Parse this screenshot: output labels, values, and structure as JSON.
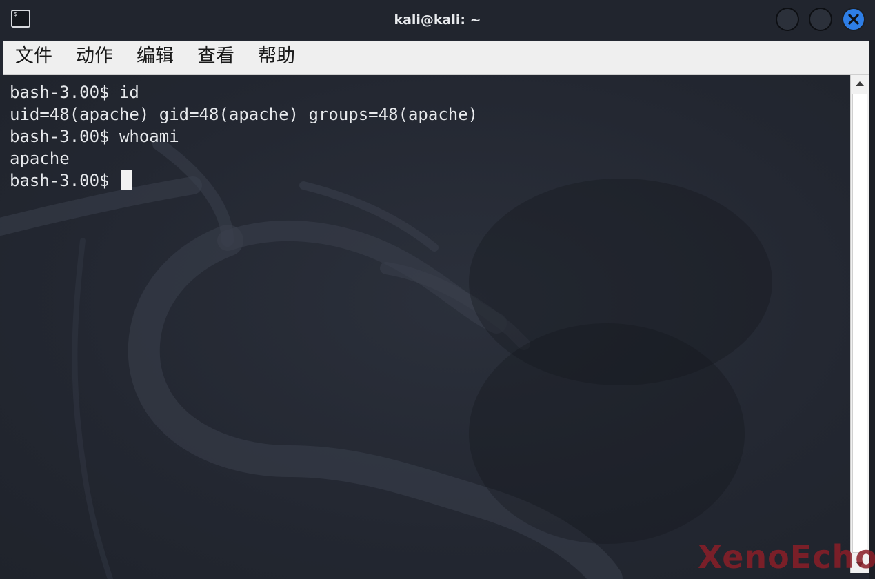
{
  "window": {
    "title": "kali@kali: ~",
    "app_icon_glyph": "$_",
    "app_icon": "terminal-icon",
    "close_icon": "close-icon"
  },
  "menu": {
    "items": [
      {
        "label": "文件"
      },
      {
        "label": "动作"
      },
      {
        "label": "编辑"
      },
      {
        "label": "查看"
      },
      {
        "label": "帮助"
      }
    ]
  },
  "terminal": {
    "lines": [
      "bash-3.00$ id",
      "uid=48(apache) gid=48(apache) groups=48(apache)",
      "bash-3.00$ whoami",
      "apache",
      "bash-3.00$"
    ]
  },
  "watermark": "XenoEcho",
  "colors": {
    "close_button": "#2e7ee6",
    "terminal_bg": "#232731",
    "terminal_fg": "#e7e9ec",
    "menubar_bg": "#efefef",
    "watermark": "#8a1e28"
  }
}
